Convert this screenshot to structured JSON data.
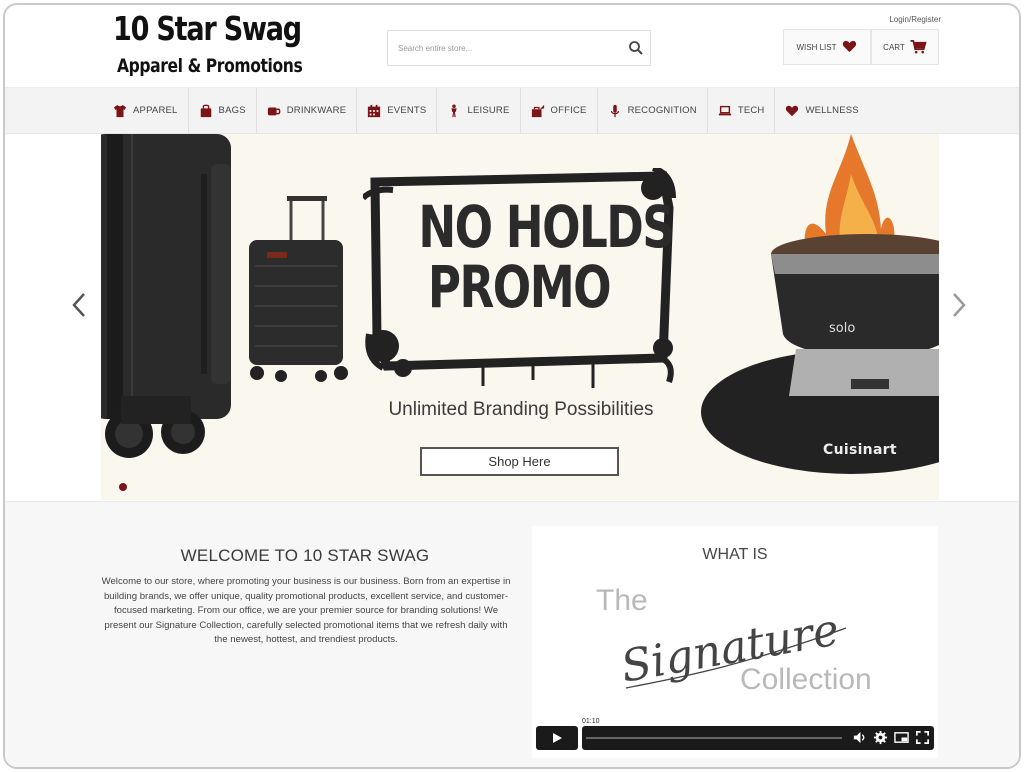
{
  "header": {
    "logo_line1": "10 Star Swag",
    "logo_line2": "Apparel & Promotions",
    "search_placeholder": "Search entire store...",
    "login_label": "Login/Register",
    "wishlist_label": "WISH LIST",
    "cart_label": "CART",
    "accent_color": "#7a1416"
  },
  "nav": {
    "items": [
      {
        "label": "APPAREL",
        "icon": "shirt-icon"
      },
      {
        "label": "BAGS",
        "icon": "bag-icon"
      },
      {
        "label": "DRINKWARE",
        "icon": "mug-icon"
      },
      {
        "label": "EVENTS",
        "icon": "calendar-icon"
      },
      {
        "label": "LEISURE",
        "icon": "person-icon"
      },
      {
        "label": "OFFICE",
        "icon": "briefcase-icon"
      },
      {
        "label": "RECOGNITION",
        "icon": "microphone-icon"
      },
      {
        "label": "TECH",
        "icon": "laptop-icon"
      },
      {
        "label": "WELLNESS",
        "icon": "heart-icon"
      }
    ]
  },
  "banner": {
    "title_line1": "NO HOLDS",
    "title_line2": "PROMO",
    "subtitle": "Unlimited Branding Possibilities",
    "button_label": "Shop Here",
    "product_brand": "Cuisinart",
    "fire_pit_label": "Cuisinart"
  },
  "welcome": {
    "title": "WELCOME TO 10 STAR SWAG",
    "text": "Welcome to our store, where promoting your business is our business. Born from an expertise in building brands, we offer unique, quality promotional products, excellent service, and customer-focused marketing. From our office, we are your premier source for branding solutions! We present our Signature Collection, carefully selected promotional items that we refresh daily with the newest, hottest, and trendiest products."
  },
  "video": {
    "heading": "WHAT IS",
    "sig_the": "The",
    "sig_script": "Signature",
    "sig_collection": "Collection",
    "timestamp": "01:10"
  }
}
